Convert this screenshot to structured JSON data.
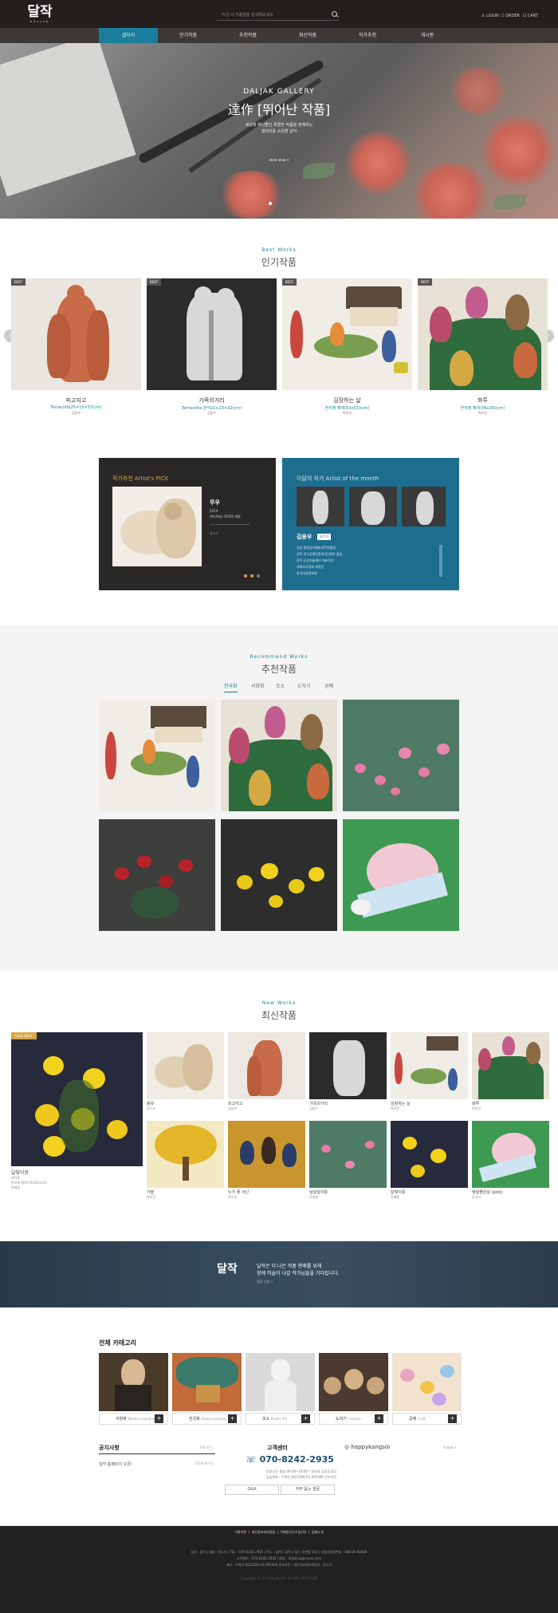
{
  "header": {
    "logo_text": "달작",
    "logo_sub": "DALJAK",
    "search_placeholder": "지금 너 작품명을 검색해보세요",
    "util": [
      "LOGIN",
      "ORDER",
      "CART"
    ]
  },
  "nav": {
    "items": [
      "갤러리",
      "인기작품",
      "추천작품",
      "최신작품",
      "작가추천",
      "게시판"
    ],
    "active": 0
  },
  "hero": {
    "subtitle": "DALJAK GALLERY",
    "title": "達作 [뛰어난 작품]",
    "desc1": "세상에 하나뿐인 특별한 작품을 판매하는",
    "desc2": "갤러리를 소유할 달작",
    "button": "more view +"
  },
  "best": {
    "en": "Best Works",
    "ko": "인기작품",
    "badge": "BEST",
    "items": [
      {
        "title": "피고지고",
        "meta": "Terracotta25×15×37(cm)",
        "artist": "김용우"
      },
      {
        "title": "가족의거리",
        "meta": "Terracotta 원석21×13×32(cm)",
        "artist": "김용우"
      },
      {
        "title": "김장하는 날",
        "meta": "한지에 채색(53x53)(cm)",
        "artist": "박유민"
      },
      {
        "title": "화투",
        "meta": "한지에 채색(36x29)(cm)",
        "artist": "박유민"
      }
    ]
  },
  "pick": {
    "title_ko": "작가추천",
    "title_en": "Artist's PICK",
    "work": "무우",
    "year": "2019",
    "meta": "백자토8x 32505 제원·",
    "artist": "강소리"
  },
  "month": {
    "title_ko": "이달의 작가",
    "title_en": "Artist of the month",
    "name": "김용우",
    "tag": "조각가",
    "lines": [
      "경남 홍천남자예술대학원졸업",
      "경주 한국공예진흥회(동양화) 졸업",
      "광주 공공미술센터 대표작가",
      "세계조각협회 회원전",
      "한국미술협회원"
    ]
  },
  "recommend": {
    "en": "Recommend Works",
    "ko": "추천작품",
    "tabs": [
      "한국화",
      "서양화",
      "조소",
      "도자기",
      "공예"
    ]
  },
  "newworks": {
    "en": "New Works",
    "ko": "최신작품",
    "badge": "Daily Work",
    "feature": {
      "title": "달빛이몽",
      "year": "2019",
      "meta": "한지에 채색(70x50)(cm)",
      "artist": "윤혜원"
    },
    "items": [
      {
        "title": "몽유",
        "artist": "강소리"
      },
      {
        "title": "피고지고",
        "artist": "김용우"
      },
      {
        "title": "가족의거리",
        "artist": "김용우"
      },
      {
        "title": "김장하는 날",
        "artist": "박유민"
      },
      {
        "title": "화투",
        "artist": "박유민"
      },
      {
        "title": "가을",
        "artist": "박유민"
      },
      {
        "title": "누가 꽃 아닌",
        "artist": "박유민"
      },
      {
        "title": "날날달이몽",
        "artist": "윤혜원"
      },
      {
        "title": "달빛이몽",
        "artist": "윤혜원"
      },
      {
        "title": "햇살좋은날 (pink)",
        "artist": "강소리"
      }
    ]
  },
  "banner": {
    "logo": "달작",
    "line1": "달작은 더 나은 작품 판매를 위해",
    "line2": "함께 미술이 나갈 작가님들을 기다립니다.",
    "link": "입점 신청 +"
  },
  "categories": {
    "title": "전체 카테고리",
    "items": [
      {
        "ko": "서양화",
        "en": "Western painting"
      },
      {
        "ko": "한국화",
        "en": "Korean painting"
      },
      {
        "ko": "조소",
        "en": "Plastic Art"
      },
      {
        "ko": "도자기",
        "en": "Ceramic"
      },
      {
        "ko": "공예",
        "en": "Craft"
      }
    ]
  },
  "notice": {
    "title": "공지사항",
    "more": "전체 보기",
    "item": "일작 홈페이지 오픈!",
    "date": "2019-08-01"
  },
  "cs": {
    "title": "고객센터",
    "phone": "070-8242-2935",
    "hours": "운영시간: 평일 09:00~18:00 * 일요일 공휴일 휴무",
    "account": "입금계좌 : 우체국 4022586-01-005446 문조라민",
    "qa": "Q&A",
    "faq": "자주 묻는 질문"
  },
  "insta": {
    "handle": "happykangsoi",
    "follow": "Follow +"
  },
  "footer": {
    "links": [
      "이용약관",
      "개인정보처리방침",
      "이메일무단수집거부",
      "업체소개"
    ],
    "info1": "상호 : 달작  |  대표 : 문소라  |  TEL : 070-8242-2935  |  주소 : 경기도 광주시 남구 대천동 101  |  사업자등록번호 : 000-00-00000",
    "info2": "고객센터 : 070-8242-2935  |  메일 : daljakso@naver.com",
    "info3": "계좌 : 우체국 4022586-01-005446 문조라민  |  개인정보관리책임자 : 문소라",
    "copy": "Copyright © 달작 DALJAK ALL RIGHTS RESERVED"
  }
}
